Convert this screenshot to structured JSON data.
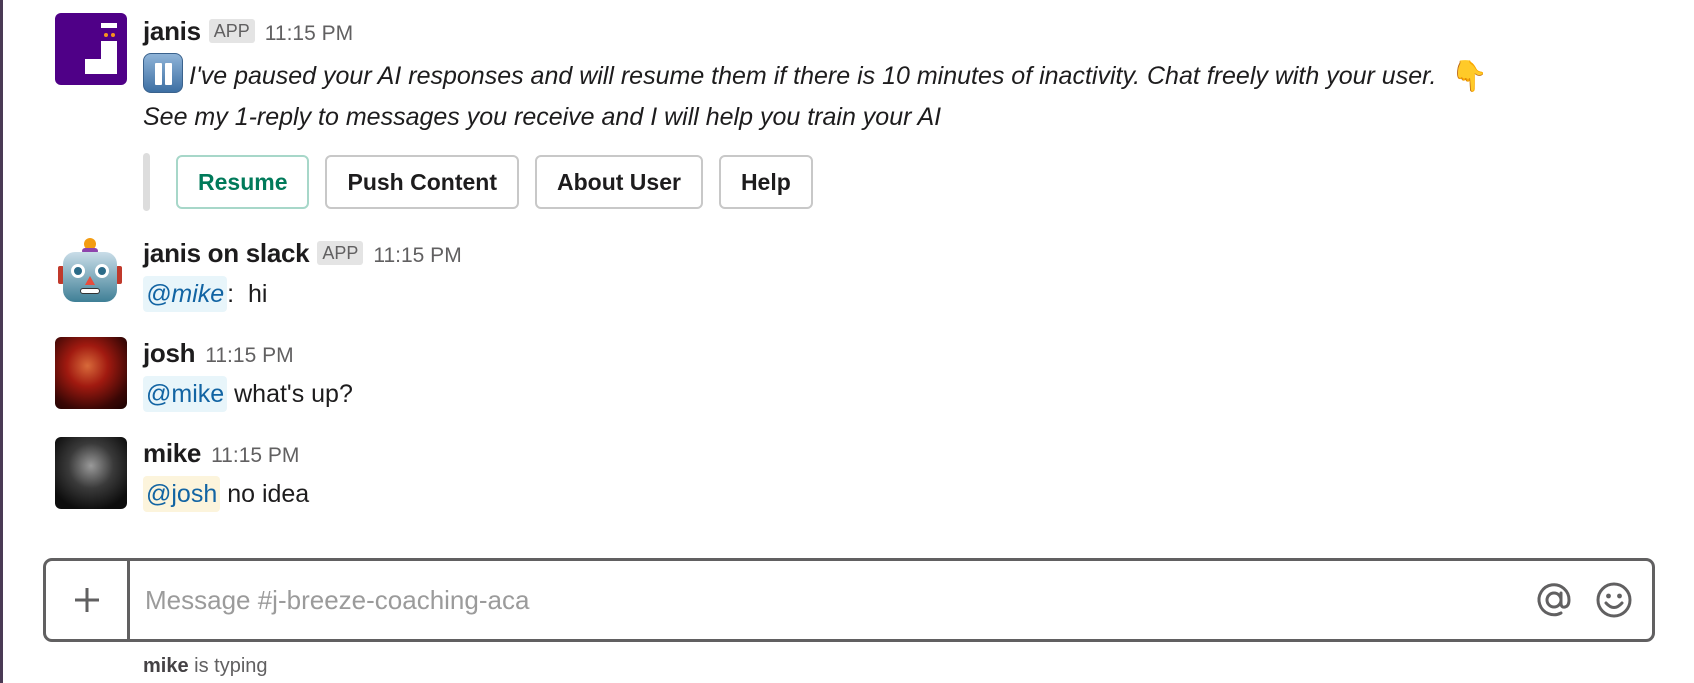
{
  "messages": [
    {
      "sender": "janis",
      "badge": "APP",
      "time": "11:15 PM",
      "avatar": "janis-logo",
      "icon_lead": "pause-button-emoji",
      "line1": "I've paused your AI responses and will resume them if there is 10 minutes of inactivity. Chat freely with your user.",
      "icon_trail": "backhand-index-pointing-down-emoji",
      "line2": "See my 1-reply to messages you receive and I will help you train your AI",
      "buttons": [
        {
          "label": "Resume",
          "style": "primary"
        },
        {
          "label": "Push Content"
        },
        {
          "label": "About User"
        },
        {
          "label": "Help"
        }
      ]
    },
    {
      "sender": "janis on slack",
      "badge": "APP",
      "time": "11:15 PM",
      "avatar": "robot-emoji",
      "mention": "@mike",
      "text": ":  hi"
    },
    {
      "sender": "josh",
      "time": "11:15 PM",
      "avatar": "josh-photo",
      "mention": "@mike",
      "text": " what's up?"
    },
    {
      "sender": "mike",
      "time": "11:15 PM",
      "avatar": "mike-photo",
      "mention": "@josh",
      "text": " no idea"
    }
  ],
  "composer": {
    "placeholder": "Message #j-breeze-coaching-aca",
    "value": "",
    "icons": [
      "plus-icon",
      "at-icon",
      "emoji-icon"
    ]
  },
  "typing": {
    "user": "mike",
    "text": " is typing"
  },
  "colors": {
    "janis_purple": "#4f0087",
    "mention_text": "#1264a3",
    "mention_bg_other": "#e8f5fa",
    "mention_bg_self": "#fcf4dc",
    "primary_button": "#007a5a",
    "composer_border": "#616061"
  }
}
